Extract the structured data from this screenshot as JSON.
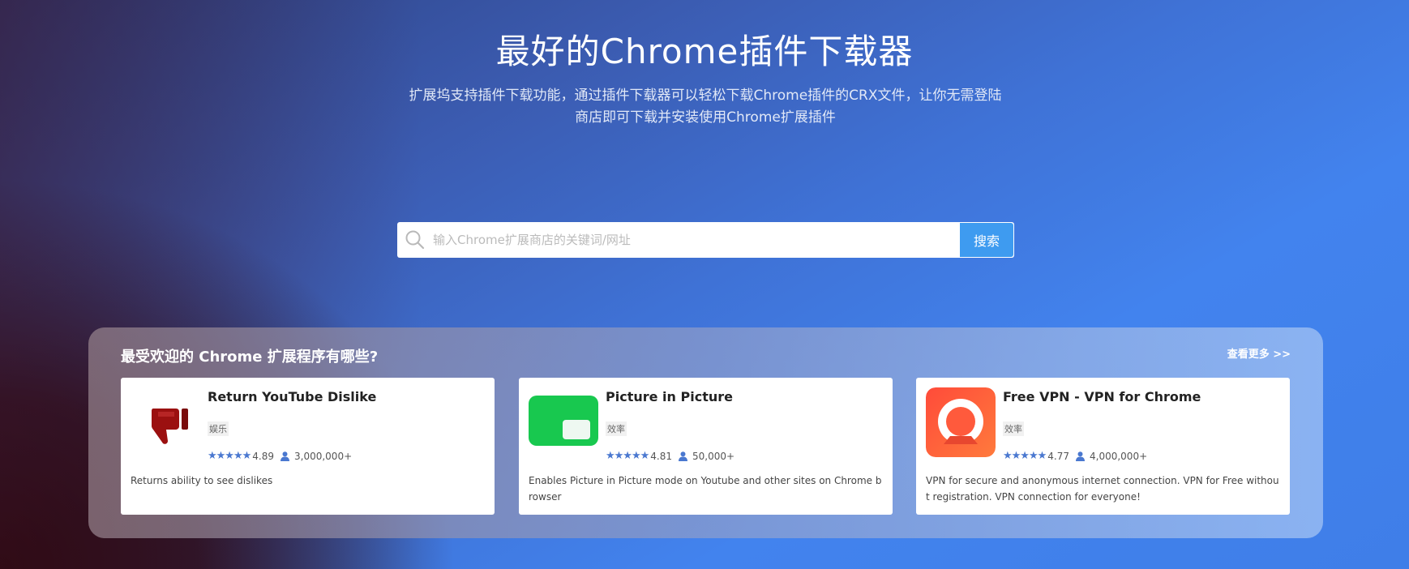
{
  "hero": {
    "title": "最好的Chrome插件下载器",
    "subtitle_line1": "扩展坞支持插件下载功能，通过插件下载器可以轻松下载Chrome插件的CRX文件，让你无需登陆",
    "subtitle_line2": "商店即可下载并安装使用Chrome扩展插件"
  },
  "search": {
    "placeholder": "输入Chrome扩展商店的关键词/网址",
    "value": "",
    "button_label": "搜索",
    "icon": "search-icon"
  },
  "popular": {
    "title": "最受欢迎的 Chrome 扩展程序有哪些?",
    "more_label": "查看更多 >>",
    "cards": [
      {
        "name": "Return YouTube Dislike",
        "category": "娱乐",
        "stars": "★★★★★",
        "rating": "4.89",
        "users": "3,000,000+",
        "description": "Returns ability to see dislikes",
        "icon": "thumbs-down-icon",
        "icon_color": "#a01212"
      },
      {
        "name": "Picture in Picture",
        "category": "效率",
        "stars": "★★★★★",
        "rating": "4.81",
        "users": "50,000+",
        "description": "Enables Picture in Picture mode on Youtube and other sites on Chrome browser",
        "icon": "picture-in-picture-icon",
        "icon_color": "#18c84f"
      },
      {
        "name": "Free VPN - VPN for Chrome",
        "category": "效率",
        "stars": "★★★★★",
        "rating": "4.77",
        "users": "4,000,000+",
        "description": "VPN for secure and anonymous internet connection. VPN for Free without registration. VPN connection for everyone!",
        "icon": "vpn-ring-icon",
        "icon_color": "#ff5a3c"
      }
    ]
  },
  "colors": {
    "accent": "#3e9bf0",
    "star": "#4a78d0"
  }
}
